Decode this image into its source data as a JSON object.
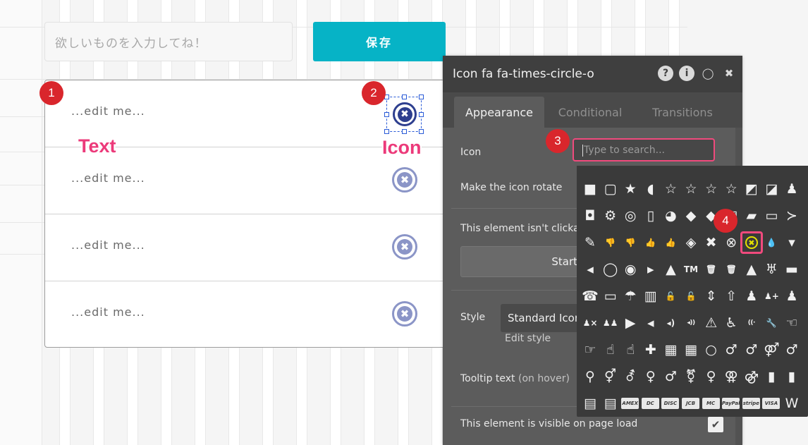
{
  "editor": {
    "input_placeholder": "欲しいものを入力してね！",
    "save_button": "保存"
  },
  "list": {
    "rows": [
      {
        "text": "...edit me..."
      },
      {
        "text": "...edit me..."
      },
      {
        "text": "...edit me..."
      },
      {
        "text": "...edit me..."
      }
    ],
    "icon_glyph": "✖"
  },
  "annotations": {
    "badge_1": "1",
    "badge_2": "2",
    "badge_3": "3",
    "badge_4": "4",
    "label_text": "Text",
    "label_icon": "Icon"
  },
  "panel": {
    "title": "Icon fa fa-times-circle-o",
    "header_icons": [
      "question-icon",
      "info-icon",
      "comment-icon",
      "close-icon"
    ],
    "header_glyphs": [
      "?",
      "i",
      "◯",
      "✖"
    ],
    "tabs": [
      {
        "label": "Appearance",
        "active": true
      },
      {
        "label": "Conditional",
        "active": false
      },
      {
        "label": "Transitions",
        "active": false
      }
    ],
    "icon_label": "Icon",
    "search_placeholder": "Type to search...",
    "rotate_label": "Make the icon rotate",
    "clickable_label": "This element isn't clickal",
    "start_button": "Start/E",
    "style_label": "Style",
    "style_value": "Standard Icon",
    "edit_style": "Edit style",
    "tooltip_label": "Tooltip text",
    "tooltip_hint": "(on hover)",
    "visible_label": "This element is visible on page load",
    "visible_checked": "✔"
  },
  "picker": {
    "rows": [
      [
        "■",
        "▢",
        "★",
        "◖",
        "☆",
        "☆",
        "☆",
        "☆",
        "◩",
        "◪",
        "♟"
      ],
      [
        "◘",
        "⚙",
        "◎",
        "▯",
        "◕",
        "◆",
        "◆",
        "▤",
        "▰",
        "▭",
        "≻"
      ],
      [
        "✎",
        "👎",
        "👎",
        "👍",
        "👍",
        "◈",
        "✖",
        "⊗",
        "⊗",
        "💧",
        "▾"
      ],
      [
        "◂",
        "◯",
        "◉",
        "▸",
        "▲",
        "TM",
        "🗑",
        "🗑",
        "▲",
        "♅",
        "▬"
      ],
      [
        "☎",
        "▭",
        "☂",
        "▥",
        "🔓",
        "🔓",
        "⇕",
        "⇧",
        "♟",
        "♟+",
        "♟"
      ],
      [
        "♟×",
        "♟♟",
        "▶",
        "◂",
        "◂)",
        "◂))",
        "⚠",
        "♿",
        "((·",
        "🔧",
        "☜"
      ],
      [
        "☞",
        "☝",
        "☝",
        "✚",
        "▦",
        "▦",
        "○",
        "♂",
        "♂",
        "⚤",
        "♂"
      ],
      [
        "⚲",
        "⚥",
        "⚦",
        "♀",
        "♂",
        "⚧",
        "♀",
        "⚢",
        "⚣",
        "▮",
        "▮"
      ],
      [
        "▤",
        "▤",
        "AMEX",
        "DC",
        "DISC",
        "JCB",
        "MC",
        "PayPal",
        "stripe",
        "VISA",
        "W"
      ]
    ],
    "selected": {
      "row": 2,
      "col": 8
    }
  }
}
